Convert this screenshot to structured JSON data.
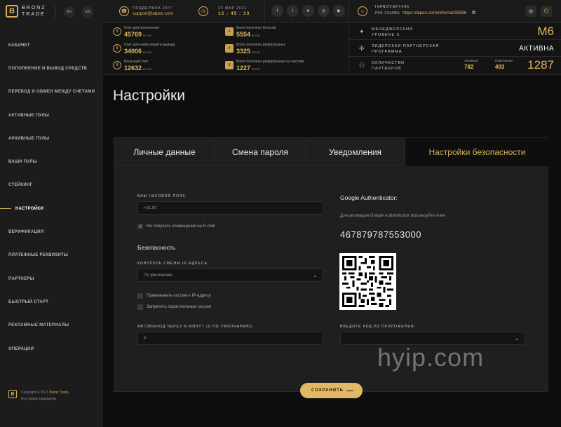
{
  "brand": {
    "name": "BRONZ TRADE",
    "mark": "B"
  },
  "languages": [
    "RU",
    "EN"
  ],
  "header": {
    "support_label": "ПОДДЕРЖКА 24/7",
    "support_email": "support@alpex.com",
    "date": "25 МАР 2021",
    "time": "12 : 45 : 33",
    "socials": [
      "f",
      "t",
      "tg",
      "ig",
      "yt"
    ],
    "username": "IVANOVSKY345",
    "ref_label": "РЕФ. ССЫЛКА:",
    "ref_link": "https://alpex.com/referral/35896"
  },
  "sidebar": {
    "items": [
      {
        "label": "КАБИНЕТ"
      },
      {
        "label": "ПОПОЛНЕНИЕ И ВЫВОД СРЕДСТВ"
      },
      {
        "label": "ПЕРЕВОД И ОБМЕН МЕЖДУ СЧЕТАМИ"
      },
      {
        "label": "АКТИВНЫЕ ПУЛЫ"
      },
      {
        "label": "АРХИВНЫЕ ПУЛЫ"
      },
      {
        "label": "ВАШИ ПУЛЫ"
      },
      {
        "label": "СТЕЙКИНГ"
      },
      {
        "label": "НАСТРОЙКИ"
      },
      {
        "label": "ВЕРИФИКАЦИЯ"
      },
      {
        "label": "ПЛАТЕЖНЫЕ РЕКВИЗИТЫ"
      },
      {
        "label": "ПАРТНЕРЫ"
      },
      {
        "label": "БЫСТРЫЙ СТАРТ"
      },
      {
        "label": "РЕКЛАМНЫЕ МАТЕРИАЛЫ"
      },
      {
        "label": "ОПЕРАЦИИ"
      }
    ],
    "footer_copyright": "Copyright © 2021",
    "footer_brand": "Bronz Trade.",
    "footer_rights": "Все права защищены."
  },
  "stats": {
    "left": [
      {
        "label": "Счет для пополнения",
        "value": "45769",
        "unit": "BRONZ"
      },
      {
        "label": "Счет для начислений и вывода",
        "value": "34006",
        "unit": "BRONZ"
      },
      {
        "label": "Бонусный счет",
        "value": "12632",
        "unit": "BRONZ"
      }
    ],
    "mid": [
      {
        "label": "Всего получено бонусов",
        "value": "5554",
        "unit": "BRONZ"
      },
      {
        "label": "Всего получено реферальных",
        "value": "3325",
        "unit": "BRONZ"
      },
      {
        "label": "Всего получено реферальных на пассиве",
        "value": "1227",
        "unit": "BRONZ"
      }
    ],
    "right": {
      "manager_label1": "МЕНЕДЖЕРСКИЙ",
      "manager_label2": "УРОВЕНЬ 3",
      "manager_value": "M6",
      "leader_label1": "ЛИДЕРСКАЯ ПАРТНЕРСКАЯ",
      "leader_label2": "ПРОГРАММА",
      "leader_value": "АКТИВНА",
      "partners_label1": "КОЛИЧЕСТВО",
      "partners_label2": "ПАРТНЕРОВ",
      "active_label": "Активных",
      "active_value": "782",
      "inactive_label": "Неактивных",
      "inactive_value": "493",
      "partners_total": "1287"
    }
  },
  "page": {
    "title": "Настройки"
  },
  "tabs": [
    {
      "label": "Личные данные"
    },
    {
      "label": "Смена пароля"
    },
    {
      "label": "Уведомления"
    },
    {
      "label": "Настройки безопасности"
    }
  ],
  "form": {
    "timezone_label": "ВАШ ЧАСОВОЙ ПОЯС:",
    "timezone_value": "+01.00",
    "no_email_label": "Не получать оповещения на E-mail",
    "security_heading": "Безопасность",
    "ip_control_label": "КОНТРОЛЬ СМЕНЫ IP-АДРЕСА:",
    "ip_control_value": "По умолчанию",
    "bind_ip_label": "Привязывать сессию к IP-адресу",
    "no_parallel_label": "Запретить параллельные сессии",
    "autologout_label": "АВТОВЫХОД ЧЕРЕЗ N МИНУТ (0 ПО УМОЛЧАНИЮ):",
    "autologout_value": "0",
    "ga_heading": "Google Authenticator:",
    "ga_hint": "Для активации Google Authenticator используйте ключ",
    "ga_key": "467879787553000",
    "app_code_label": "ВВЕДИТЕ КОД ИЗ ПРИЛОЖЕНИЯ:",
    "app_code_value": "",
    "save_label": "СОХРАНИТЬ"
  },
  "watermark": {
    "text": "hyip.com"
  },
  "colors": {
    "accent": "#d9b15a",
    "bg": "#0d0d0d",
    "panel": "#1f1f1f",
    "sidebar": "#1c1c1c"
  }
}
